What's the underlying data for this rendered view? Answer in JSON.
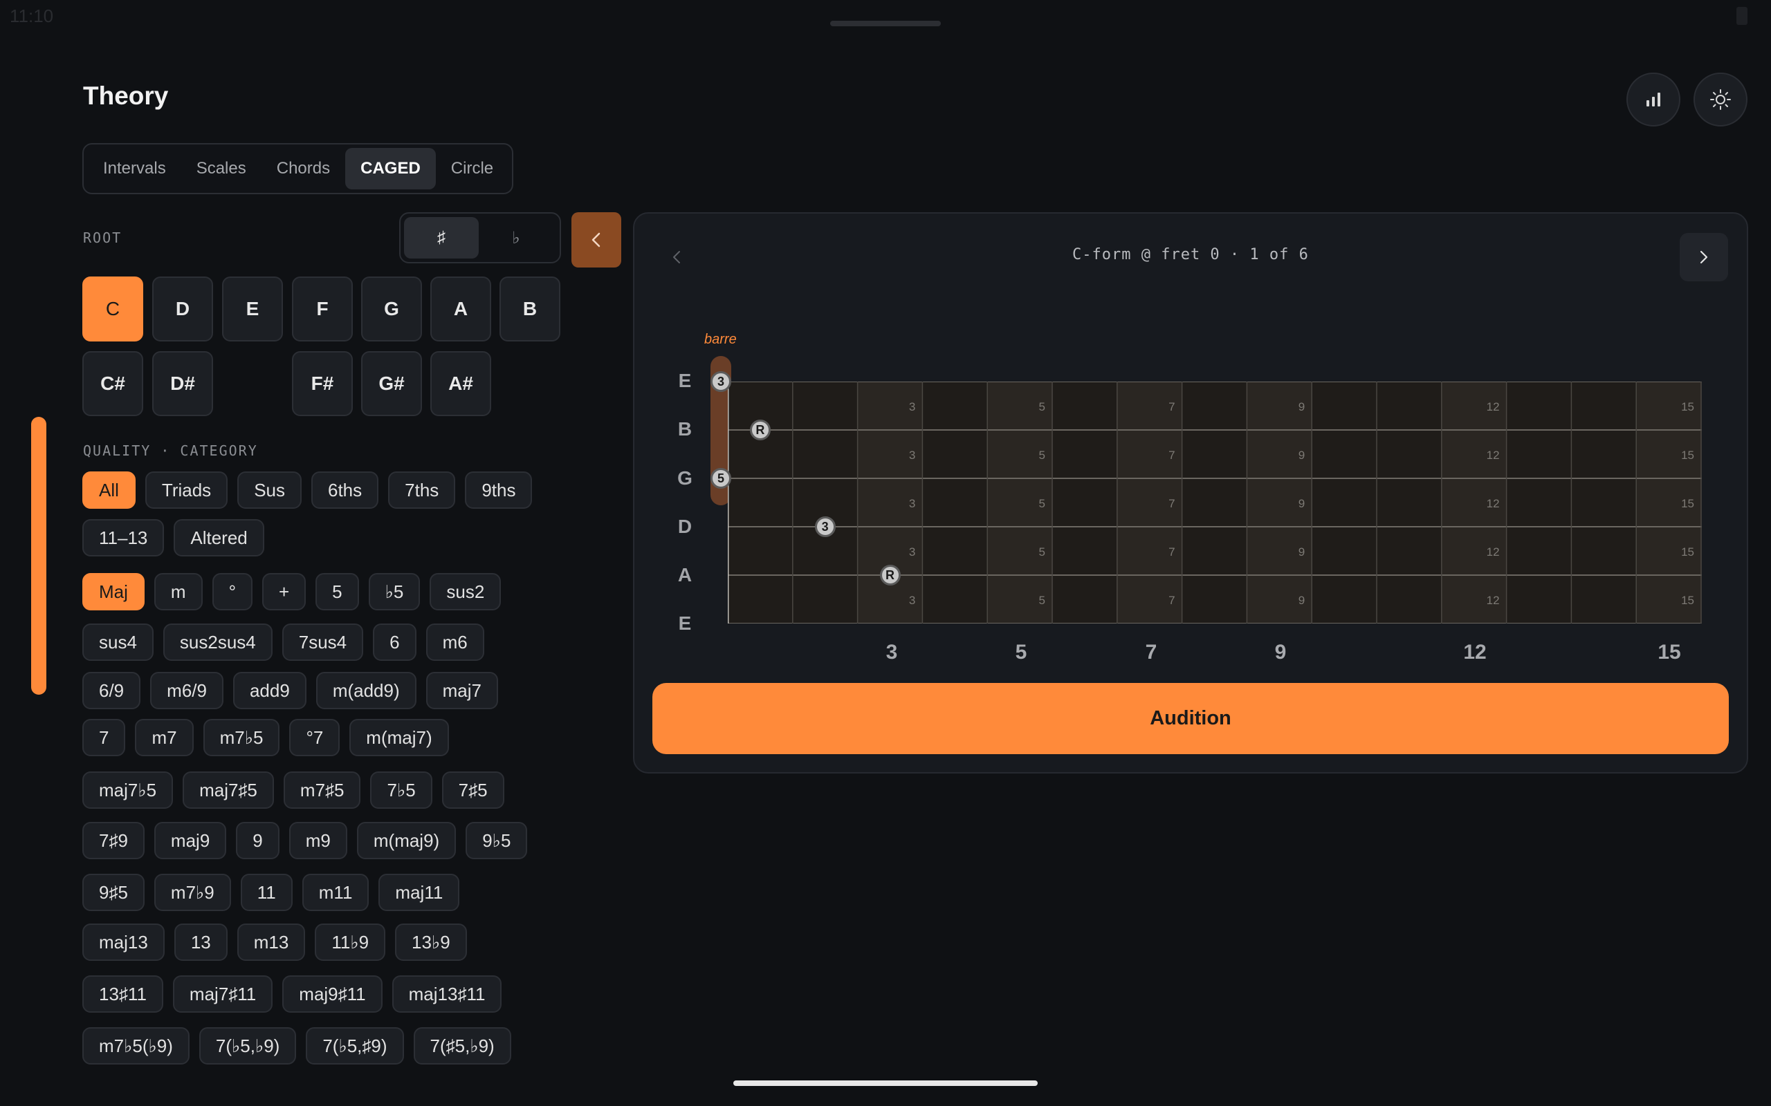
{
  "status": {
    "time": "11:10"
  },
  "title": "Theory",
  "header_icons": [
    "chart-icon",
    "brightness-icon"
  ],
  "tabs": [
    {
      "label": "Intervals",
      "active": false
    },
    {
      "label": "Scales",
      "active": false
    },
    {
      "label": "Chords",
      "active": false
    },
    {
      "label": "CAGED",
      "active": true
    },
    {
      "label": "Circle",
      "active": false
    }
  ],
  "root": {
    "label": "ROOT",
    "accidentals": {
      "sharp": "♯",
      "flat": "♭",
      "selected": "sharp"
    },
    "naturals": [
      "C",
      "D",
      "E",
      "F",
      "G",
      "A",
      "B"
    ],
    "sharps": [
      "C#",
      "D#",
      "F#",
      "G#",
      "A#"
    ],
    "selected": "C"
  },
  "quality": {
    "label": "QUALITY · CATEGORY",
    "categories": [
      "All",
      "Triads",
      "Sus",
      "6ths",
      "7ths",
      "9ths",
      "11–13",
      "Altered"
    ],
    "selected_category": "All",
    "chords": [
      [
        "Maj",
        "m",
        "°",
        "+",
        "5",
        "♭5",
        "sus2"
      ],
      [
        "sus4",
        "sus2sus4",
        "7sus4",
        "6",
        "m6"
      ],
      [
        "6/9",
        "m6/9",
        "add9",
        "m(add9)",
        "maj7"
      ],
      [
        "7",
        "m7",
        "m7♭5",
        "°7",
        "m(maj7)"
      ],
      [
        "maj7♭5",
        "maj7♯5",
        "m7♯5",
        "7♭5",
        "7♯5"
      ],
      [
        "7♯9",
        "maj9",
        "9",
        "m9",
        "m(maj9)",
        "9♭5"
      ],
      [
        "9♯5",
        "m7♭9",
        "11",
        "m11",
        "maj11"
      ],
      [
        "maj13",
        "13",
        "m13",
        "11♭9",
        "13♭9"
      ],
      [
        "13♯11",
        "maj7♯11",
        "maj9♯11",
        "maj13♯11"
      ],
      [
        "m7♭5(♭9)",
        "7(♭5,♭9)",
        "7(♭5,♯9)",
        "7(♯5,♭9)"
      ]
    ],
    "selected_chord": "Maj"
  },
  "caged": {
    "caption": "C-form @ fret 0 · 1 of 6",
    "barre_label": "barre",
    "strings": [
      "E",
      "B",
      "G",
      "D",
      "A",
      "E"
    ],
    "fret_markers": [
      "3",
      "5",
      "7",
      "9",
      "12",
      "15"
    ],
    "notes": [
      {
        "string": 1,
        "fret": 0,
        "label": "3"
      },
      {
        "string": 2,
        "fret": 1,
        "label": "R"
      },
      {
        "string": 3,
        "fret": 0,
        "label": "5"
      },
      {
        "string": 4,
        "fret": 2,
        "label": "3"
      },
      {
        "string": 5,
        "fret": 3,
        "label": "R"
      }
    ],
    "action_label": "Audition"
  }
}
